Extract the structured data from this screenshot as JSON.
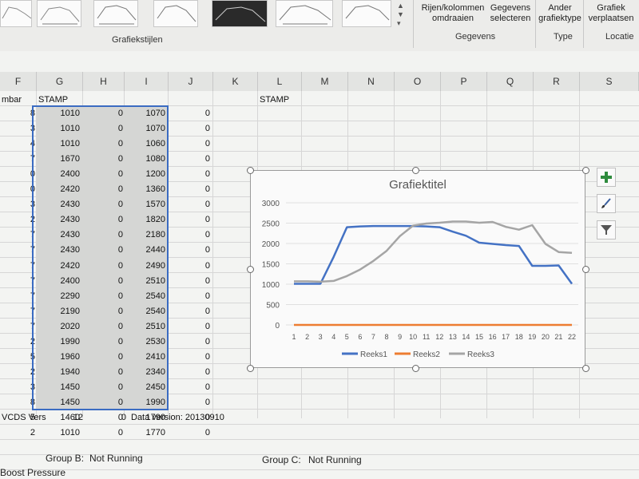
{
  "ribbon": {
    "group_styles_label": "Grafiekstijlen",
    "btn_switch": "Rijen/kolommen omdraaien",
    "btn_select_data": "Gegevens selecteren",
    "group_data_label": "Gegevens",
    "btn_change_type": "Ander grafiektype",
    "group_type_label": "Type",
    "btn_move_chart": "Grafiek verplaatsen",
    "group_location_label": "Locatie"
  },
  "columns": [
    "F",
    "G",
    "H",
    "I",
    "J",
    "K",
    "L",
    "M",
    "N",
    "O",
    "P",
    "Q",
    "R",
    "S"
  ],
  "sheet": {
    "header_F": "mbar",
    "header_G": "STAMP",
    "header_L": "STAMP",
    "rows": [
      {
        "f": "8",
        "g": "1010",
        "h": "0",
        "i": "1070",
        "j": "0"
      },
      {
        "f": "3",
        "g": "1010",
        "h": "0",
        "i": "1070",
        "j": "0"
      },
      {
        "f": "4",
        "g": "1010",
        "h": "0",
        "i": "1060",
        "j": "0"
      },
      {
        "f": "7",
        "g": "1670",
        "h": "0",
        "i": "1080",
        "j": "0"
      },
      {
        "f": "0",
        "g": "2400",
        "h": "0",
        "i": "1200",
        "j": "0"
      },
      {
        "f": "0",
        "g": "2420",
        "h": "0",
        "i": "1360",
        "j": "0"
      },
      {
        "f": "3",
        "g": "2430",
        "h": "0",
        "i": "1570",
        "j": "0"
      },
      {
        "f": "2",
        "g": "2430",
        "h": "0",
        "i": "1820",
        "j": "0"
      },
      {
        "f": "7",
        "g": "2430",
        "h": "0",
        "i": "2180",
        "j": "0"
      },
      {
        "f": "7",
        "g": "2430",
        "h": "0",
        "i": "2440",
        "j": "0"
      },
      {
        "f": "7",
        "g": "2420",
        "h": "0",
        "i": "2490",
        "j": "0"
      },
      {
        "f": "7",
        "g": "2400",
        "h": "0",
        "i": "2510",
        "j": "0"
      },
      {
        "f": "7",
        "g": "2290",
        "h": "0",
        "i": "2540",
        "j": "0"
      },
      {
        "f": "7",
        "g": "2190",
        "h": "0",
        "i": "2540",
        "j": "0"
      },
      {
        "f": "7",
        "g": "2020",
        "h": "0",
        "i": "2510",
        "j": "0"
      },
      {
        "f": "2",
        "g": "1990",
        "h": "0",
        "i": "2530",
        "j": "0"
      },
      {
        "f": "5",
        "g": "1960",
        "h": "0",
        "i": "2410",
        "j": "0"
      },
      {
        "f": "2",
        "g": "1940",
        "h": "0",
        "i": "2340",
        "j": "0"
      },
      {
        "f": "3",
        "g": "1450",
        "h": "0",
        "i": "2450",
        "j": "0"
      },
      {
        "f": "8",
        "g": "1450",
        "h": "0",
        "i": "1990",
        "j": "0"
      },
      {
        "f": "5",
        "g": "1460",
        "h": "0",
        "i": "1790",
        "j": "0"
      },
      {
        "f": "2",
        "g": "1010",
        "h": "0",
        "i": "1770",
        "j": "0"
      }
    ],
    "footer_f": "VCDS Vers",
    "footer_g": "12",
    "footer_h": "0",
    "footer_i": "Data version: 20130910",
    "group_b_label": "Group B:",
    "group_b_value": "Not Running",
    "group_c_label": "Group C:",
    "group_c_value": "Not Running",
    "boost_label": "Boost Pressure"
  },
  "colors": {
    "series1": "#4472c4",
    "series2": "#ed7d31",
    "series3": "#a5a5a5",
    "selection": "#3b6cc2",
    "plus_icon": "#2e8b3d"
  },
  "chart_data": {
    "type": "line",
    "title": "Grafiektitel",
    "x": [
      1,
      2,
      3,
      4,
      5,
      6,
      7,
      8,
      9,
      10,
      11,
      12,
      13,
      14,
      15,
      16,
      17,
      18,
      19,
      20,
      21,
      22
    ],
    "ylim": [
      0,
      3000
    ],
    "yticks": [
      0,
      500,
      1000,
      1500,
      2000,
      2500,
      3000
    ],
    "grid": true,
    "legend": "bottom",
    "series": [
      {
        "name": "Reeks1",
        "values": [
          1010,
          1010,
          1010,
          1670,
          2400,
          2420,
          2430,
          2430,
          2430,
          2430,
          2420,
          2400,
          2290,
          2190,
          2020,
          1990,
          1960,
          1940,
          1450,
          1450,
          1460,
          1010
        ]
      },
      {
        "name": "Reeks2",
        "values": [
          0,
          0,
          0,
          0,
          0,
          0,
          0,
          0,
          0,
          0,
          0,
          0,
          0,
          0,
          0,
          0,
          0,
          0,
          0,
          0,
          0,
          0
        ]
      },
      {
        "name": "Reeks3",
        "values": [
          1070,
          1070,
          1060,
          1080,
          1200,
          1360,
          1570,
          1820,
          2180,
          2440,
          2490,
          2510,
          2540,
          2540,
          2510,
          2530,
          2410,
          2340,
          2450,
          1990,
          1790,
          1770
        ]
      }
    ]
  }
}
